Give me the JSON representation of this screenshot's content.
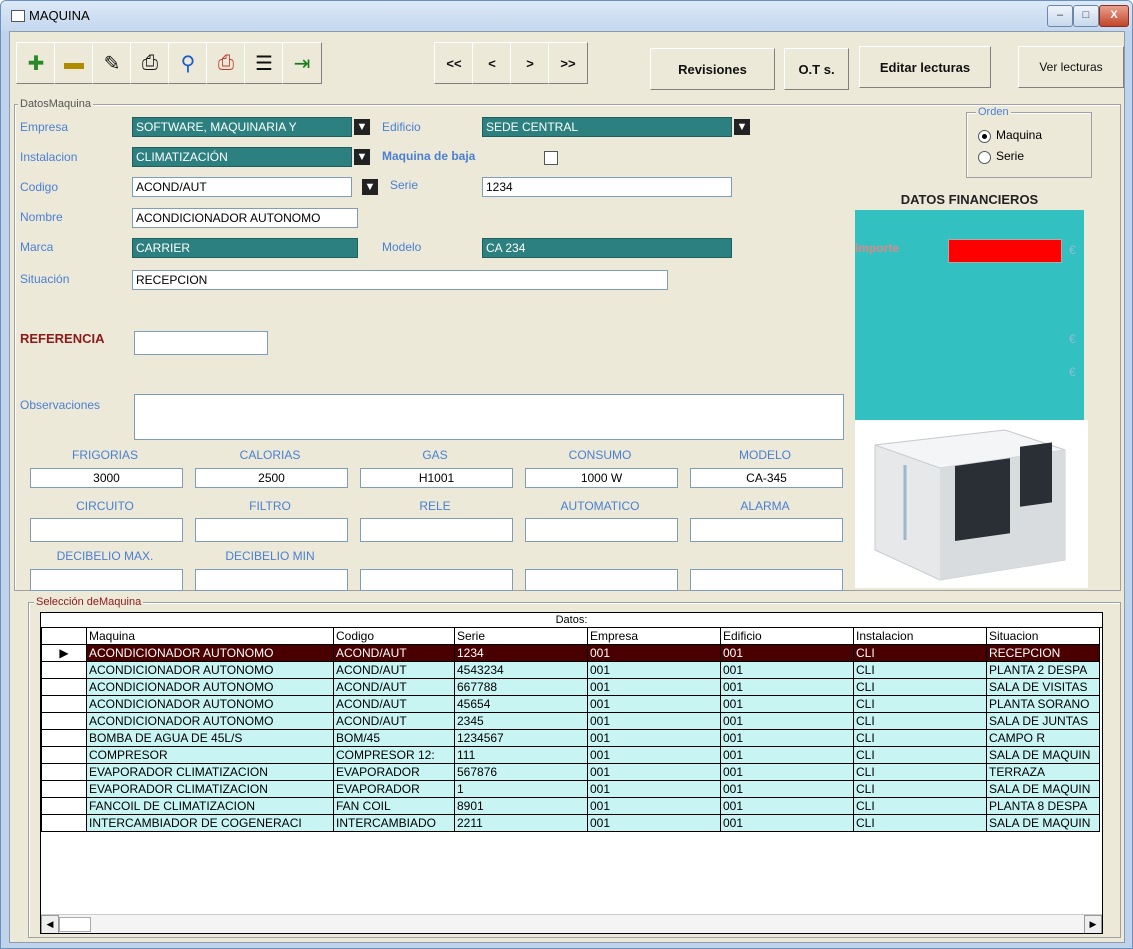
{
  "window": {
    "title": "MAQUINA",
    "btn_min": "–",
    "btn_max": "□",
    "btn_close": "X"
  },
  "toolbar": {
    "icons": [
      "add-record-icon",
      "delete-record-icon",
      "edit-record-icon",
      "print-icon",
      "search-icon",
      "print-preview-icon",
      "export-icon",
      "exit-icon"
    ],
    "nav": [
      "<<",
      "<",
      ">",
      ">>"
    ],
    "revisiones": "Revisiones",
    "ots": "O.T s.",
    "editar_lecturas": "Editar lecturas",
    "ver_lecturas": "Ver lecturas"
  },
  "datos_maquina": {
    "group_title": "DatosMaquina",
    "empresa_label": "Empresa",
    "empresa_value": "SOFTWARE, MAQUINARIA Y",
    "edificio_label": "Edificio",
    "edificio_value": "SEDE CENTRAL",
    "instalacion_label": "Instalacion",
    "instalacion_value": "CLIMATIZACIÓN",
    "baja_label": "Maquina de baja",
    "codigo_label": "Codigo",
    "codigo_value": "ACOND/AUT",
    "serie_label": "Serie",
    "serie_value": "1234",
    "nombre_label": "Nombre",
    "nombre_value": "ACONDICIONADOR AUTONOMO",
    "marca_label": "Marca",
    "marca_value": "CARRIER",
    "modelo_label": "Modelo",
    "modelo_value": "CA 234",
    "situacion_label": "Situación",
    "situacion_value": "RECEPCION",
    "referencia_label": "REFERENCIA",
    "referencia_value": "",
    "observaciones_label": "Observaciones",
    "observaciones_value": ""
  },
  "orden": {
    "title": "Orden",
    "opt1": "Maquina",
    "opt2": "Serie",
    "selected": "Maquina"
  },
  "financiero": {
    "title": "DATOS FINANCIEROS",
    "importe_label": "Importe",
    "currency": "€",
    "importe_color": "#ff0000"
  },
  "specs": {
    "row1_labels": [
      "FRIGORIAS",
      "CALORIAS",
      "GAS",
      "CONSUMO",
      "MODELO"
    ],
    "row1_values": [
      "3000",
      "2500",
      "H1001",
      "1000 W",
      "CA-345"
    ],
    "row2_labels": [
      "CIRCUITO",
      "FILTRO",
      "RELE",
      "AUTOMATICO",
      "ALARMA"
    ],
    "row2_values": [
      "",
      "",
      "",
      "",
      ""
    ],
    "row3_labels": [
      "DECIBELIO MAX.",
      "DECIBELIO MIN"
    ],
    "row3_values": [
      "",
      "",
      "",
      "",
      ""
    ]
  },
  "seleccion": {
    "group_title": "Selección deMaquina",
    "caption": "Datos:",
    "columns": [
      "Maquina",
      "Codigo",
      "Serie",
      "Empresa",
      "Edificio",
      "Instalacion",
      "Situacion"
    ],
    "rows": [
      [
        "ACONDICIONADOR AUTONOMO",
        "ACOND/AUT",
        "1234",
        "001",
        "001",
        "CLI",
        "RECEPCION"
      ],
      [
        "ACONDICIONADOR AUTONOMO",
        "ACOND/AUT",
        "4543234",
        "001",
        "001",
        "CLI",
        "PLANTA 2 DESPA"
      ],
      [
        "ACONDICIONADOR AUTONOMO",
        "ACOND/AUT",
        "667788",
        "001",
        "001",
        "CLI",
        "SALA DE VISITAS"
      ],
      [
        "ACONDICIONADOR AUTONOMO",
        "ACOND/AUT",
        "45654",
        "001",
        "001",
        "CLI",
        "PLANTA SORANO"
      ],
      [
        "ACONDICIONADOR AUTONOMO",
        "ACOND/AUT",
        "2345",
        "001",
        "001",
        "CLI",
        "SALA DE JUNTAS"
      ],
      [
        "BOMBA DE AGUA DE 45L/S",
        "BOM/45",
        "1234567",
        "001",
        "001",
        "CLI",
        "CAMPO R"
      ],
      [
        "COMPRESOR",
        "COMPRESOR 12:",
        "111",
        "001",
        "001",
        "CLI",
        "SALA DE MAQUIN"
      ],
      [
        "EVAPORADOR CLIMATIZACION",
        "EVAPORADOR",
        "567876",
        "001",
        "001",
        "CLI",
        "TERRAZA"
      ],
      [
        "EVAPORADOR CLIMATIZACION",
        "EVAPORADOR",
        "1",
        "001",
        "001",
        "CLI",
        "SALA DE MAQUIN"
      ],
      [
        "FANCOIL DE CLIMATIZACION",
        "FAN COIL",
        "8901",
        "001",
        "001",
        "CLI",
        "PLANTA 8 DESPA"
      ],
      [
        "INTERCAMBIADOR DE COGENERACI",
        "INTERCAMBIADO",
        "2211",
        "001",
        "001",
        "CLI",
        "SALA DE MAQUIN"
      ]
    ],
    "selected_index": 0
  },
  "colors": {
    "teal_field": "#2c8080",
    "label_blue": "#4a7fd4",
    "fin_panel": "#33c0c0",
    "grid_row": "#c8f4f4",
    "selected_row": "#4a0000"
  }
}
